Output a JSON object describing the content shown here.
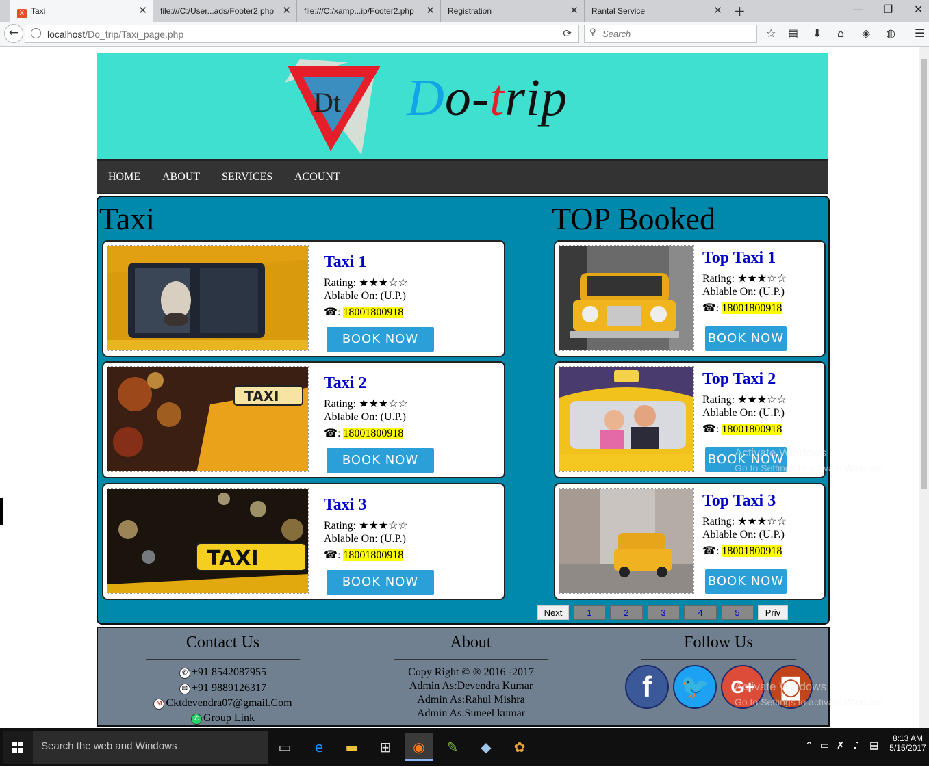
{
  "browser": {
    "tabs": [
      {
        "label": "Taxi",
        "active": true
      },
      {
        "label": "file:///C:/User...ads/Footer2.php"
      },
      {
        "label": "file:///C:/xamp...ip/Footer2.php"
      },
      {
        "label": "Registration"
      },
      {
        "label": "Rantal Service"
      }
    ],
    "favicon_text": "X",
    "url_host": "localhost",
    "url_path": "/Do_trip/Taxi_page.php",
    "search_placeholder": "Search"
  },
  "header": {
    "logo_mark_text": "Dt",
    "logo_text": {
      "d": "D",
      "o": "o-",
      "t": "t",
      "rip": "rip"
    }
  },
  "menu": [
    "HOME",
    "ABOUT",
    "SERVICES",
    "ACOUNT"
  ],
  "taxi_section": {
    "title": "Taxi",
    "cards": [
      {
        "name": "Taxi 1",
        "rating": "Rating: ★★★☆☆",
        "available": "Ablable On: (U.P.)",
        "phone_icon": "☎",
        "phone_sep": ": ",
        "phone": "18001800918",
        "button": "BOOK NOW",
        "photo": "dog-in-yellow-cab"
      },
      {
        "name": "Taxi 2",
        "rating": "Rating: ★★★☆☆",
        "available": "Ablable On: (U.P.)",
        "phone_icon": "☎",
        "phone_sep": ": ",
        "phone": "18001800918",
        "button": "BOOK NOW",
        "photo": "taxi-sign-night-bokeh"
      },
      {
        "name": "Taxi 3",
        "rating": "Rating: ★★★☆☆",
        "available": "Ablable On: (U.P.)",
        "phone_icon": "☎",
        "phone_sep": ": ",
        "phone": "18001800918",
        "button": "BOOK NOW",
        "photo": "taxi-roof-sign-bokeh"
      }
    ]
  },
  "top_section": {
    "title": "TOP Booked",
    "cards": [
      {
        "name": "Top Taxi 1",
        "rating": "Rating: ★★★☆☆",
        "available": "Ablable On: (U.P.)",
        "phone_icon": "☎",
        "phone_sep": ": ",
        "phone": "18001800918",
        "button": "BOOK NOW",
        "photo": "vintage-checker-cab"
      },
      {
        "name": "Top Taxi 2",
        "rating": "Rating: ★★★☆☆",
        "available": "Ablable On: (U.P.)",
        "phone_icon": "☎",
        "phone_sep": ": ",
        "phone": "18001800918",
        "button": "BOOK NOW",
        "photo": "cartoon-couple-in-taxi"
      },
      {
        "name": "Top Taxi 3",
        "rating": "Rating: ★★★☆☆",
        "available": "Ablable On: (U.P.)",
        "phone_icon": "☎",
        "phone_sep": ": ",
        "phone": "18001800918",
        "button": "BOOK NOW",
        "photo": "toy-taxi-street"
      }
    ]
  },
  "pager": {
    "next": "Next",
    "pages": [
      "1",
      "2",
      "3",
      "4",
      "5"
    ],
    "prev": "Priv"
  },
  "footer": {
    "contact": {
      "title": "Contact Us",
      "phone1": "+91 8542087955",
      "phone2": "+91 9889126317",
      "email": "Cktdevendra07@gmail.Com",
      "group": "Group Link"
    },
    "about": {
      "title": "About",
      "copyright": "Copy Right © ® 2016 -2017",
      "admins": [
        "Admin As:Devendra Kumar",
        "Admin As:Rahul Mishra",
        "Admin As:Suneel kumar"
      ]
    },
    "follow": {
      "title": "Follow Us",
      "networks": [
        {
          "icon": "facebook-icon",
          "glyph": "f",
          "color": "#3b5998"
        },
        {
          "icon": "twitter-icon",
          "glyph": "🐦",
          "color": "#1da1f2"
        },
        {
          "icon": "google-plus-icon",
          "glyph": "G+",
          "color": "#dd4b39"
        },
        {
          "icon": "instagram-icon",
          "glyph": "◙",
          "color": "#c1441b"
        }
      ]
    }
  },
  "watermark": {
    "line1": "Activate Windows",
    "line2": "Go to Settings to activate Windows."
  },
  "taskbar": {
    "search": "Search the web and Windows",
    "time": "8:13 AM",
    "date": "5/15/2017"
  }
}
